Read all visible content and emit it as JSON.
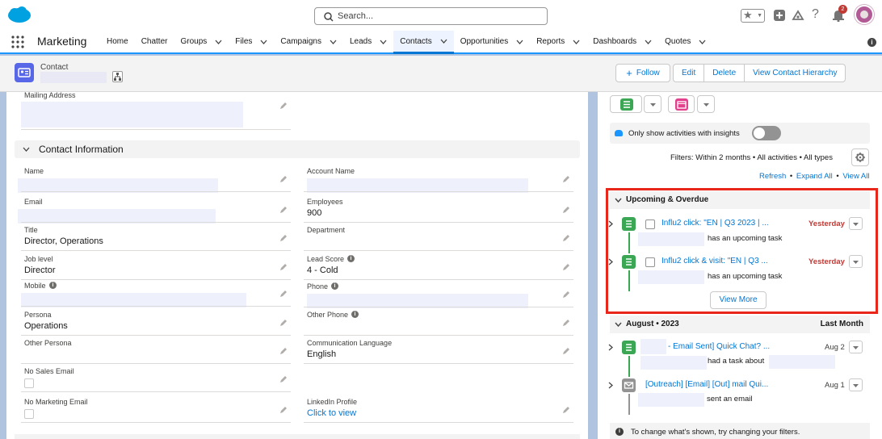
{
  "search": {
    "placeholder": "Search..."
  },
  "header": {
    "notification_count": "2"
  },
  "nav": {
    "app_name": "Marketing",
    "items": [
      {
        "label": "Home",
        "has_menu": false,
        "active": false
      },
      {
        "label": "Chatter",
        "has_menu": false,
        "active": false
      },
      {
        "label": "Groups",
        "has_menu": true,
        "active": false
      },
      {
        "label": "Files",
        "has_menu": true,
        "active": false
      },
      {
        "label": "Campaigns",
        "has_menu": true,
        "active": false
      },
      {
        "label": "Leads",
        "has_menu": true,
        "active": false
      },
      {
        "label": "Contacts",
        "has_menu": true,
        "active": true
      },
      {
        "label": "Opportunities",
        "has_menu": true,
        "active": false
      },
      {
        "label": "Reports",
        "has_menu": true,
        "active": false
      },
      {
        "label": "Dashboards",
        "has_menu": true,
        "active": false
      },
      {
        "label": "Quotes",
        "has_menu": true,
        "active": false
      }
    ]
  },
  "record": {
    "object_type": "Contact",
    "actions": {
      "follow": "Follow",
      "edit": "Edit",
      "delete": "Delete",
      "hierarchy": "View Contact Hierarchy"
    }
  },
  "details": {
    "mailing_address_label": "Mailing Address",
    "section_title": "Contact Information",
    "left_fields": [
      {
        "label": "Name",
        "value": "",
        "info": false
      },
      {
        "label": "Email",
        "value": "",
        "info": false
      },
      {
        "label": "Title",
        "value": "Director, Operations",
        "info": false
      },
      {
        "label": "Job level",
        "value": "Director",
        "info": false
      },
      {
        "label": "Mobile",
        "value": "",
        "info": true
      },
      {
        "label": "Persona",
        "value": "Operations",
        "info": false
      },
      {
        "label": "Other Persona",
        "value": "",
        "info": false
      },
      {
        "label": "No Sales Email",
        "value": "",
        "info": false
      },
      {
        "label": "No Marketing Email",
        "value": "",
        "info": false
      }
    ],
    "right_fields": [
      {
        "label": "Account Name",
        "value": "",
        "info": false
      },
      {
        "label": "Employees",
        "value": "900",
        "info": false
      },
      {
        "label": "Department",
        "value": "",
        "info": false
      },
      {
        "label": "Lead Score",
        "value": "4 - Cold",
        "info": true
      },
      {
        "label": "Phone",
        "value": "",
        "info": true
      },
      {
        "label": "Other Phone",
        "value": "",
        "info": true
      },
      {
        "label": "Communication Language",
        "value": "English",
        "info": false
      },
      {
        "label": "LinkedIn Profile",
        "value": "Click to view",
        "info": false
      }
    ]
  },
  "activity": {
    "insights_toggle_label": "Only show activities with insights",
    "insights_enabled": false,
    "filters_text": "Filters: Within 2 months • All activities • All types",
    "links": {
      "refresh": "Refresh",
      "expand_all": "Expand All",
      "view_all": "View All",
      "separator": "•"
    },
    "upcoming": {
      "title": "Upcoming & Overdue",
      "items": [
        {
          "title": "Influ2 click: \"EN | Q3 2023 | ...",
          "date": "Yesterday",
          "subtitle": "has an upcoming task"
        },
        {
          "title": "Influ2 click & visit: \"EN | Q3 ...",
          "date": "Yesterday",
          "subtitle": "has an upcoming task"
        }
      ],
      "view_more": "View More"
    },
    "august": {
      "title": "August • 2023",
      "right_label": "Last Month",
      "items": [
        {
          "title": "- Email Sent] Quick Chat?  ...",
          "date": "Aug 2",
          "subtitle": "had a task about"
        },
        {
          "title": "[Outreach] [Email] [Out] mail Qui...",
          "date": "Aug 1",
          "subtitle": "sent an email"
        }
      ]
    },
    "footnote": "To change what's shown, try changing your filters."
  },
  "colors": {
    "brand": "#0176d3",
    "task": "#3ba755",
    "event": "#e3418d",
    "overdue": "#c23934",
    "highlight": "#e8261a"
  }
}
